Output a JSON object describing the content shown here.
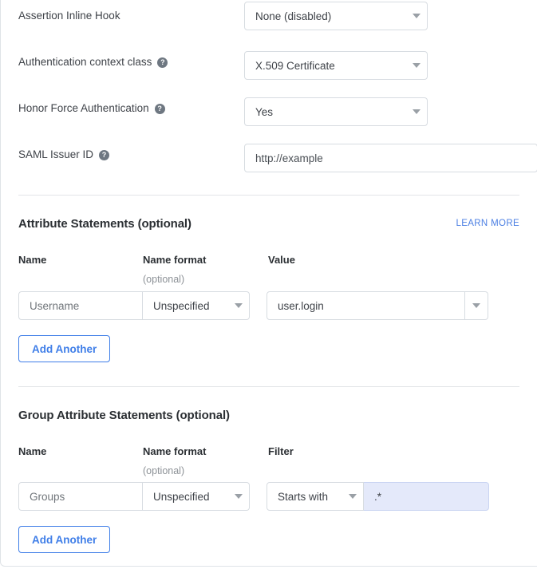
{
  "form": {
    "rows": [
      {
        "label": "Assertion Inline Hook",
        "has_help": false,
        "control": "select",
        "value": "None (disabled)"
      },
      {
        "label": "Authentication context class",
        "has_help": true,
        "help_glyph": "?",
        "control": "select",
        "value": "X.509 Certificate"
      },
      {
        "label": "Honor Force Authentication",
        "has_help": true,
        "help_glyph": "?",
        "control": "select",
        "value": "Yes"
      },
      {
        "label": "SAML Issuer ID",
        "has_help": true,
        "help_glyph": "?",
        "control": "text",
        "value": "http://example"
      }
    ]
  },
  "attribute_statements": {
    "title": "Attribute Statements (optional)",
    "learn_more": "LEARN MORE",
    "columns": [
      {
        "label": "Name",
        "sub": ""
      },
      {
        "label": "Name format",
        "sub": "(optional)"
      },
      {
        "label": "Value",
        "sub": ""
      }
    ],
    "row": {
      "name": "Username",
      "name_format": "Unspecified",
      "value": "user.login"
    },
    "add_button": "Add Another"
  },
  "group_attribute_statements": {
    "title": "Group Attribute Statements (optional)",
    "columns": [
      {
        "label": "Name",
        "sub": ""
      },
      {
        "label": "Name format",
        "sub": "(optional)"
      },
      {
        "label": "Filter",
        "sub": ""
      }
    ],
    "row": {
      "name": "Groups",
      "name_format": "Unspecified",
      "filter_operator": "Starts with",
      "filter_value": ".*"
    },
    "add_button": "Add Another"
  },
  "colors": {
    "link": "#4b7fe3",
    "button_blue": "#3f7ee8",
    "filter_highlight": "#e4e9fa",
    "border": "#d7dce1",
    "divider": "#e2e5e8",
    "text": "#3f4349",
    "heading": "#2b2f33",
    "muted": "#8c9196"
  }
}
